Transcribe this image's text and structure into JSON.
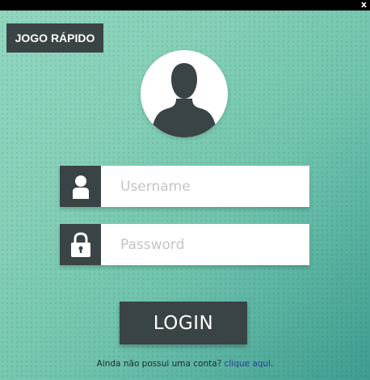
{
  "window": {
    "close_label": "x"
  },
  "quick_game": {
    "label": "JOGO RÁPIDO"
  },
  "login_form": {
    "username_placeholder": "Username",
    "password_placeholder": "Password",
    "login_label": "LOGIN"
  },
  "register": {
    "prompt": "Ainda não possui uma conta?",
    "link_label": "clique aqui",
    "suffix": "."
  },
  "icons": {
    "avatar": "user-silhouette-icon",
    "username": "user-icon",
    "password": "lock-icon",
    "close": "close-icon"
  },
  "colors": {
    "dark": "#3a4345",
    "link": "#2a3a9a",
    "bg_light": "#90d6c0",
    "bg_dark": "#3e9c8f"
  }
}
